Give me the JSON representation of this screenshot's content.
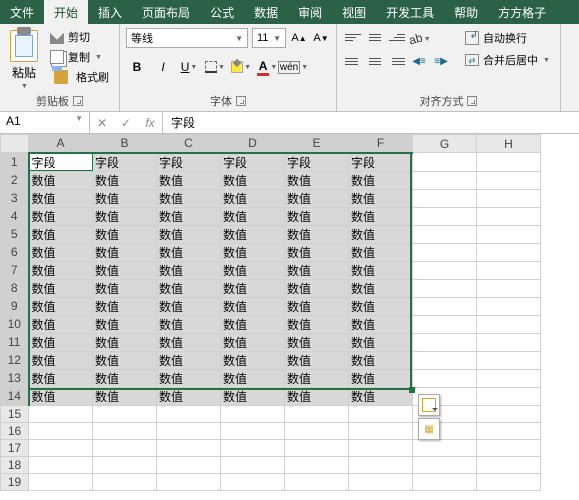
{
  "tabs": [
    "文件",
    "开始",
    "插入",
    "页面布局",
    "公式",
    "数据",
    "审阅",
    "视图",
    "开发工具",
    "帮助",
    "方方格子"
  ],
  "active_tab": 1,
  "clipboard": {
    "paste": "粘贴",
    "cut": "剪切",
    "copy": "复制",
    "brush": "格式刷",
    "group": "剪贴板"
  },
  "font": {
    "name": "等线",
    "size": "11",
    "bold": "B",
    "italic": "I",
    "underline": "U",
    "wen": "wén",
    "colorA": "A",
    "group": "字体"
  },
  "align": {
    "wrap": "自动换行",
    "merge": "合并后居中",
    "group": "对齐方式"
  },
  "namebox": "A1",
  "fx_cancel": "✕",
  "fx_ok": "✓",
  "fx_label": "fx",
  "formula": "字段",
  "columns": [
    "A",
    "B",
    "C",
    "D",
    "E",
    "F",
    "G",
    "H"
  ],
  "sel_cols": 6,
  "rows": 19,
  "sel_rows": 14,
  "header_text": "字段",
  "value_text": "数值",
  "chart_data": {
    "type": "table",
    "title": "",
    "columns": [
      "A",
      "B",
      "C",
      "D",
      "E",
      "F"
    ],
    "data": [
      [
        "字段",
        "字段",
        "字段",
        "字段",
        "字段",
        "字段"
      ],
      [
        "数值",
        "数值",
        "数值",
        "数值",
        "数值",
        "数值"
      ],
      [
        "数值",
        "数值",
        "数值",
        "数值",
        "数值",
        "数值"
      ],
      [
        "数值",
        "数值",
        "数值",
        "数值",
        "数值",
        "数值"
      ],
      [
        "数值",
        "数值",
        "数值",
        "数值",
        "数值",
        "数值"
      ],
      [
        "数值",
        "数值",
        "数值",
        "数值",
        "数值",
        "数值"
      ],
      [
        "数值",
        "数值",
        "数值",
        "数值",
        "数值",
        "数值"
      ],
      [
        "数值",
        "数值",
        "数值",
        "数值",
        "数值",
        "数值"
      ],
      [
        "数值",
        "数值",
        "数值",
        "数值",
        "数值",
        "数值"
      ],
      [
        "数值",
        "数值",
        "数值",
        "数值",
        "数值",
        "数值"
      ],
      [
        "数值",
        "数值",
        "数值",
        "数值",
        "数值",
        "数值"
      ],
      [
        "数值",
        "数值",
        "数值",
        "数值",
        "数值",
        "数值"
      ],
      [
        "数值",
        "数值",
        "数值",
        "数值",
        "数值",
        "数值"
      ],
      [
        "数值",
        "数值",
        "数值",
        "数值",
        "数值",
        "数值"
      ]
    ]
  }
}
